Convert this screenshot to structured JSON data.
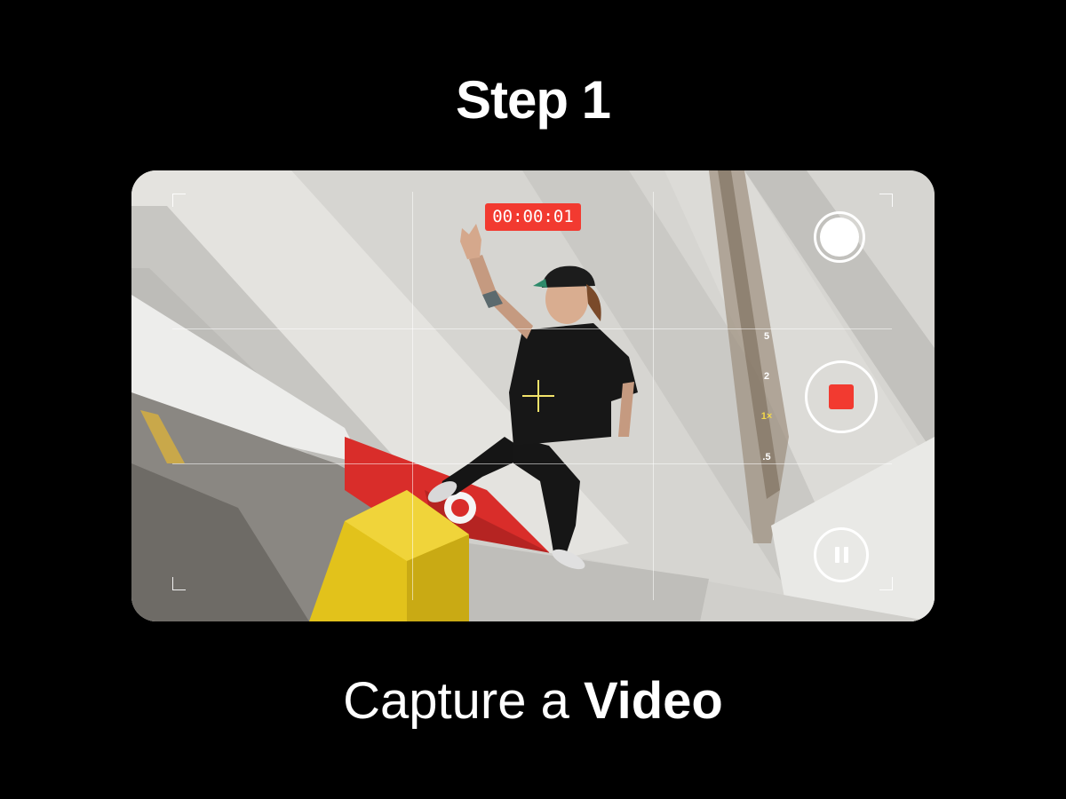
{
  "header": {
    "title": "Step 1"
  },
  "camera": {
    "timer": "00:00:01",
    "zoom_levels": [
      "5",
      "2",
      "1×",
      ".5"
    ],
    "active_zoom": "1×",
    "record_color": "#f23a30",
    "focus_color": "#f3e36a",
    "controls": {
      "shutter_icon": "camera-shutter-icon",
      "record_icon": "stop-record-icon",
      "pause_icon": "pause-icon"
    }
  },
  "caption": {
    "prefix": "Capture a ",
    "emphasis": "Video"
  }
}
